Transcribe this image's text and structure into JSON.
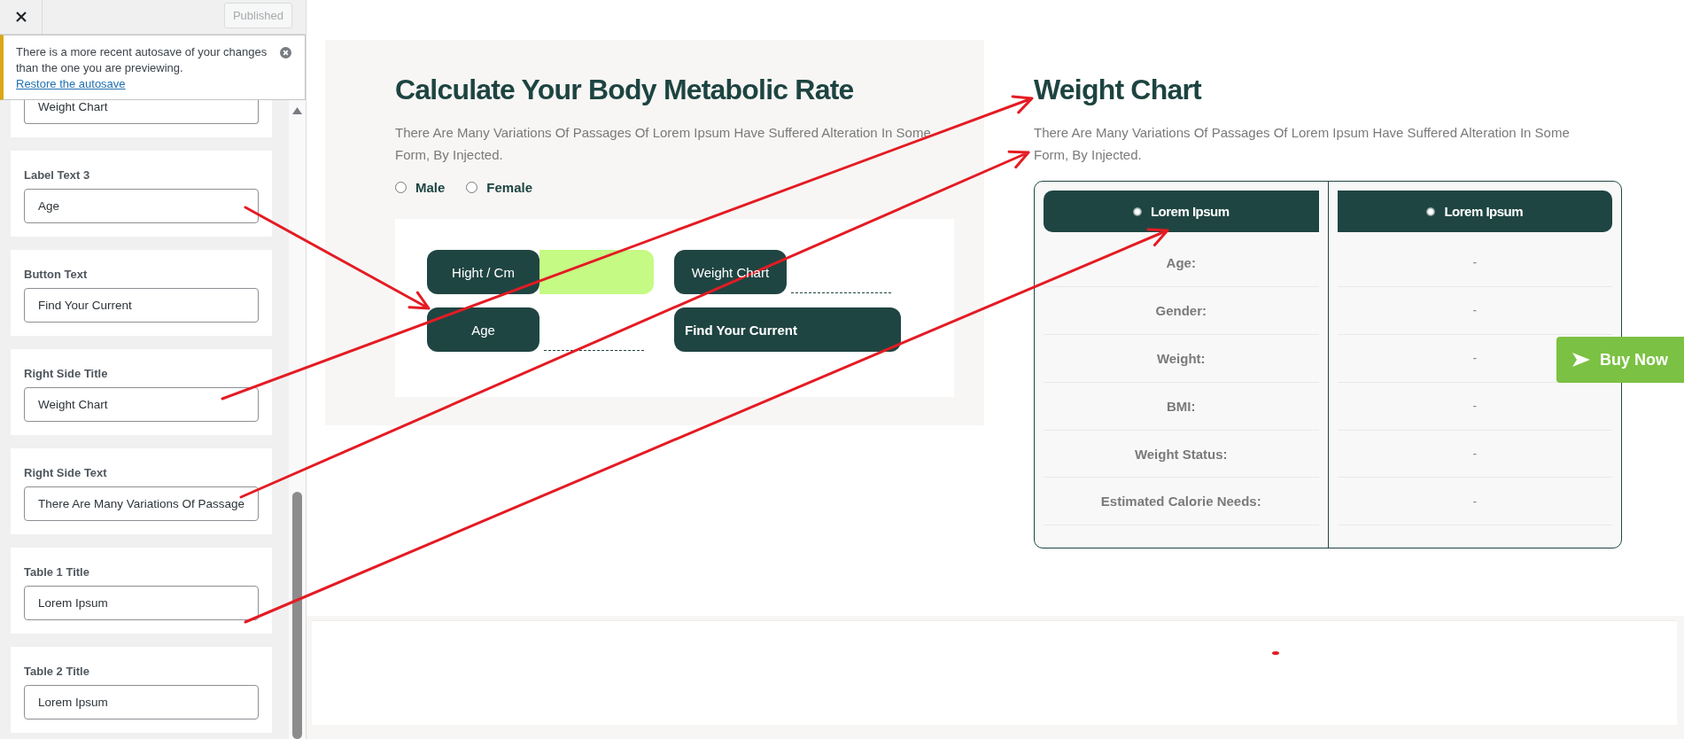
{
  "sidebar": {
    "publish": {
      "label": "Published",
      "disabled": true
    },
    "notice": {
      "text": "There is a more recent autosave of your changes than the one you are previewing.",
      "link": "Restore the autosave"
    },
    "settings": [
      {
        "value": "Weight Chart"
      },
      {
        "label": "Label Text 3",
        "value": "Age"
      },
      {
        "label": "Button Text",
        "value": "Find Your Current"
      },
      {
        "label": "Right Side Title",
        "value": "Weight Chart"
      },
      {
        "label": "Right Side Text",
        "value": "There Are Many Variations Of Passage"
      },
      {
        "label": "Table 1 Title",
        "value": "Lorem Ipsum"
      },
      {
        "label": "Table 2 Title",
        "value": "Lorem Ipsum"
      }
    ]
  },
  "calculator": {
    "title": "Calculate Your Body Metabolic Rate",
    "text": "There Are Many Variations Of Passages Of Lorem Ipsum Have Suffered Alteration In Some Form, By Injected.",
    "genders": [
      {
        "label": "Male",
        "selected": false
      },
      {
        "label": "Female",
        "selected": false
      }
    ],
    "fields": [
      {
        "label": "Hight / Cm",
        "active": true
      },
      {
        "label": "Weight Chart",
        "active": false
      },
      {
        "label": "Age",
        "active": false
      }
    ],
    "button": "Find Your Current"
  },
  "weight_chart": {
    "title": "Weight Chart",
    "text": "There Are Many Variations Of Passages Of Lorem Ipsum Have Suffered Alteration In Some Form, By Injected.",
    "columns": [
      {
        "title": "Lorem Ipsum"
      },
      {
        "title": "Lorem Ipsum"
      }
    ],
    "rows": [
      {
        "label": "Age:",
        "value": "-"
      },
      {
        "label": "Gender:",
        "value": "-"
      },
      {
        "label": "Weight:",
        "value": "-"
      },
      {
        "label": "BMI:",
        "value": "-"
      },
      {
        "label": "Weight Status:",
        "value": "-"
      },
      {
        "label": "Estimated Calorie Needs:",
        "value": "-"
      }
    ]
  },
  "buy_button": "Buy Now"
}
